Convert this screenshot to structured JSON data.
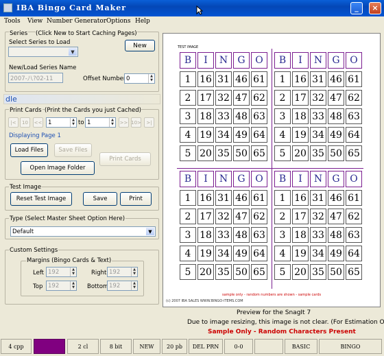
{
  "window": {
    "title": "IBA Bingo Card Maker",
    "minimize": "_",
    "maximize": "□",
    "close": "×"
  },
  "menu": [
    "Tools",
    "View",
    "Number Generator",
    "Options",
    "Help"
  ],
  "series": {
    "legend": "Series",
    "hint": "(Click New to Start Caching Pages)",
    "select_label": "Select Series to Load",
    "new_button": "New",
    "name_label": "New/Load Series Name",
    "name_value": "2007-八?02-11",
    "offset_label": "Offset Number",
    "offset_value": "0"
  },
  "idle_text": "dle",
  "print_cards": {
    "legend": "Print Cards",
    "hint": "(Print the Cards you just Cached)",
    "nav": [
      "|<",
      "10",
      "<<",
      ">>",
      "10>",
      ">|"
    ],
    "from_value": "1",
    "to_label": "to",
    "to_value": "1",
    "displaying": "Displaying Page 1",
    "load_files": "Load Files",
    "save_files": "Save Files",
    "print_cards_btn": "Print Cards",
    "open_folder": "Open Image Folder"
  },
  "test_image": {
    "legend": "Test Image",
    "reset": "Reset Test Image",
    "save": "Save",
    "print": "Print"
  },
  "type": {
    "legend": "Type  (Select Master Sheet Option Here)",
    "value": "Default"
  },
  "custom": {
    "legend": "Custom Settings",
    "margins_legend": "Margins (Bingo Cards  & Text)",
    "left_label": "Left",
    "left_value": "192",
    "right_label": "Right",
    "right_value": "192",
    "top_label": "Top",
    "top_value": "192",
    "bottom_label": "Bottom",
    "bottom_value": "192"
  },
  "preview": {
    "test_label": "TEST IMAGE",
    "header_letters": [
      "B",
      "I",
      "N",
      "G",
      "O"
    ],
    "rows": [
      [
        "1",
        "16",
        "31",
        "46",
        "61"
      ],
      [
        "2",
        "17",
        "32",
        "47",
        "62"
      ],
      [
        "3",
        "18",
        "33",
        "48",
        "63"
      ],
      [
        "4",
        "19",
        "34",
        "49",
        "64"
      ],
      [
        "5",
        "20",
        "35",
        "50",
        "65"
      ]
    ],
    "sample_note": "sample only - random numbers are shown - sample cards",
    "copyright": "(c) 2007 IBA SALES WWW.BINGO-ITEMS.COM"
  },
  "captions": {
    "line1": "Preview for the SnagIt 7",
    "line2": "Due to image resizing, this image is not clear.  (For Estimation Only)",
    "line3": "Sample Only - Random Characters Present"
  },
  "status": [
    "4 cpp",
    "",
    "2 cl",
    "8 bit",
    "NEW",
    "20 pb",
    "DEL PRN",
    "0-0",
    "",
    "BASIC",
    "BINGO"
  ],
  "colors": {
    "accent_purple": "#800080",
    "sample_red": "#cc0000",
    "title_blue": "#0447b6"
  }
}
